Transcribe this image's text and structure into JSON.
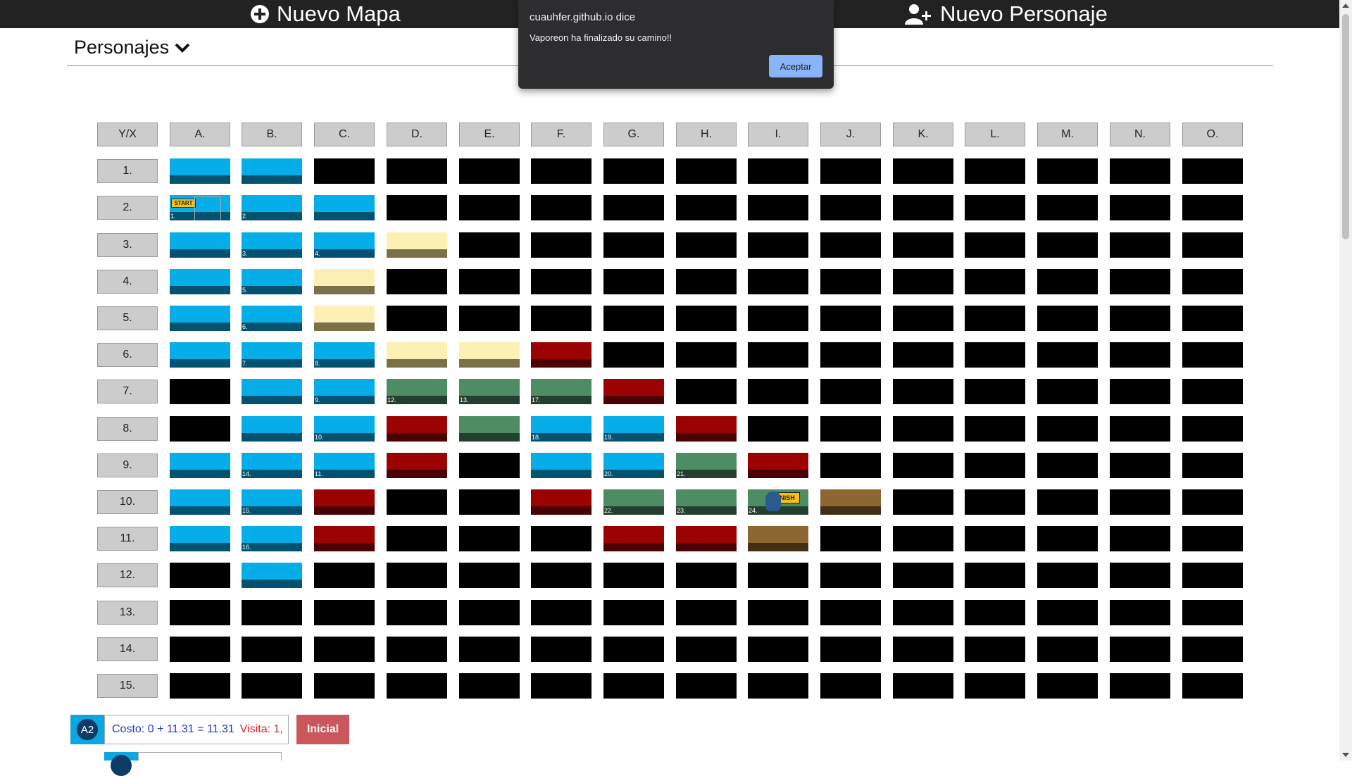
{
  "topbar": {
    "new_map_label": "Nuevo Mapa",
    "new_character_label": "Nuevo Personaje"
  },
  "personajes": {
    "label": "Personajes"
  },
  "dialog": {
    "title": "cuauhfer.github.io dice",
    "message": "Vaporeon ha finalizado su camino!!",
    "ok_label": "Aceptar"
  },
  "grid": {
    "corner": "Y/X",
    "columns": [
      "A.",
      "B.",
      "C.",
      "D.",
      "E.",
      "F.",
      "G.",
      "H.",
      "I.",
      "J.",
      "K.",
      "L.",
      "M.",
      "N.",
      "O."
    ],
    "rows": [
      "1.",
      "2.",
      "3.",
      "4.",
      "5.",
      "6.",
      "7.",
      "8.",
      "9.",
      "10.",
      "11.",
      "12.",
      "13.",
      "14.",
      "15."
    ],
    "terrain_legend": {
      "K": "unknown/black",
      "W": "water (blue)",
      "S": "sand (yellow)",
      "G": "forest (green)",
      "R": "lava (red)",
      "M": "mud (brown)"
    },
    "terrain_colors": {
      "W": [
        "#05aee8",
        "#035270"
      ],
      "S": [
        "#fdf0b4",
        "#7a7148"
      ],
      "G": [
        "#4e8c64",
        "#23402f"
      ],
      "R": [
        "#9b0303",
        "#4a0101"
      ],
      "M": [
        "#8e6632",
        "#432f16"
      ]
    },
    "cells": [
      [
        "W",
        "W",
        "K",
        "K",
        "K",
        "K",
        "K",
        "K",
        "K",
        "K",
        "K",
        "K",
        "K",
        "K",
        "K"
      ],
      [
        "W",
        "W",
        "W",
        "K",
        "K",
        "K",
        "K",
        "K",
        "K",
        "K",
        "K",
        "K",
        "K",
        "K",
        "K"
      ],
      [
        "W",
        "W",
        "W",
        "S",
        "K",
        "K",
        "K",
        "K",
        "K",
        "K",
        "K",
        "K",
        "K",
        "K",
        "K"
      ],
      [
        "W",
        "W",
        "S",
        "K",
        "K",
        "K",
        "K",
        "K",
        "K",
        "K",
        "K",
        "K",
        "K",
        "K",
        "K"
      ],
      [
        "W",
        "W",
        "S",
        "K",
        "K",
        "K",
        "K",
        "K",
        "K",
        "K",
        "K",
        "K",
        "K",
        "K",
        "K"
      ],
      [
        "W",
        "W",
        "W",
        "S",
        "S",
        "R",
        "K",
        "K",
        "K",
        "K",
        "K",
        "K",
        "K",
        "K",
        "K"
      ],
      [
        "K",
        "W",
        "W",
        "G",
        "G",
        "G",
        "R",
        "K",
        "K",
        "K",
        "K",
        "K",
        "K",
        "K",
        "K"
      ],
      [
        "K",
        "W",
        "W",
        "R",
        "G",
        "W",
        "W",
        "R",
        "K",
        "K",
        "K",
        "K",
        "K",
        "K",
        "K"
      ],
      [
        "W",
        "W",
        "W",
        "R",
        "K",
        "W",
        "W",
        "G",
        "R",
        "K",
        "K",
        "K",
        "K",
        "K",
        "K"
      ],
      [
        "W",
        "W",
        "R",
        "K",
        "K",
        "R",
        "G",
        "G",
        "G",
        "M",
        "K",
        "K",
        "K",
        "K",
        "K"
      ],
      [
        "W",
        "W",
        "R",
        "K",
        "K",
        "K",
        "R",
        "R",
        "M",
        "K",
        "K",
        "K",
        "K",
        "K",
        "K"
      ],
      [
        "K",
        "W",
        "K",
        "K",
        "K",
        "K",
        "K",
        "K",
        "K",
        "K",
        "K",
        "K",
        "K",
        "K",
        "K"
      ],
      [
        "K",
        "K",
        "K",
        "K",
        "K",
        "K",
        "K",
        "K",
        "K",
        "K",
        "K",
        "K",
        "K",
        "K",
        "K"
      ],
      [
        "K",
        "K",
        "K",
        "K",
        "K",
        "K",
        "K",
        "K",
        "K",
        "K",
        "K",
        "K",
        "K",
        "K",
        "K"
      ],
      [
        "K",
        "K",
        "K",
        "K",
        "K",
        "K",
        "K",
        "K",
        "K",
        "K",
        "K",
        "K",
        "K",
        "K",
        "K"
      ]
    ],
    "visit_numbers": [
      {
        "row": 2,
        "col": 1,
        "label": "1."
      },
      {
        "row": 2,
        "col": 2,
        "label": "2."
      },
      {
        "row": 3,
        "col": 2,
        "label": "3."
      },
      {
        "row": 3,
        "col": 3,
        "label": "4."
      },
      {
        "row": 4,
        "col": 2,
        "label": "5."
      },
      {
        "row": 5,
        "col": 2,
        "label": "6."
      },
      {
        "row": 6,
        "col": 2,
        "label": "7."
      },
      {
        "row": 6,
        "col": 3,
        "label": "8."
      },
      {
        "row": 7,
        "col": 3,
        "label": "9."
      },
      {
        "row": 8,
        "col": 3,
        "label": "10."
      },
      {
        "row": 9,
        "col": 3,
        "label": "11."
      },
      {
        "row": 7,
        "col": 4,
        "label": "12."
      },
      {
        "row": 7,
        "col": 5,
        "label": "13."
      },
      {
        "row": 9,
        "col": 2,
        "label": "14."
      },
      {
        "row": 10,
        "col": 2,
        "label": "15."
      },
      {
        "row": 11,
        "col": 2,
        "label": "16."
      },
      {
        "row": 7,
        "col": 6,
        "label": "17."
      },
      {
        "row": 8,
        "col": 6,
        "label": "18."
      },
      {
        "row": 8,
        "col": 7,
        "label": "19."
      },
      {
        "row": 9,
        "col": 7,
        "label": "20."
      },
      {
        "row": 9,
        "col": 8,
        "label": "21."
      },
      {
        "row": 10,
        "col": 7,
        "label": "22."
      },
      {
        "row": 10,
        "col": 8,
        "label": "23."
      },
      {
        "row": 10,
        "col": 9,
        "label": "24."
      }
    ],
    "start": {
      "row": 2,
      "col": 1,
      "label": "START"
    },
    "finish": {
      "row": 10,
      "col": 9,
      "label": "FINISH"
    }
  },
  "status": {
    "badge": "A2",
    "cost_text": "Costo: 0 + 11.31 = 11.31",
    "visit_text": "Visita: 1,",
    "inicial_label": "Inicial"
  }
}
